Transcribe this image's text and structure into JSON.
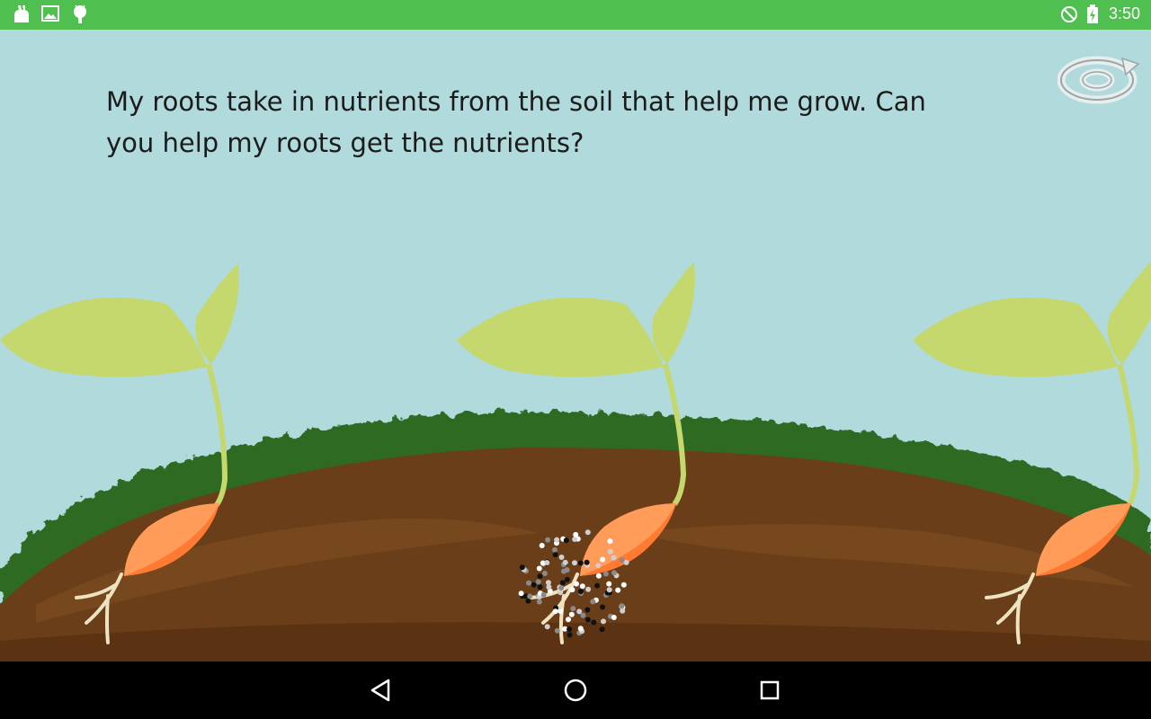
{
  "status_bar": {
    "time": "3:50",
    "left_icons": [
      "bunny-icon",
      "image-icon",
      "android-icon"
    ],
    "right_icons": [
      "no-sim-icon",
      "battery-charging-icon"
    ],
    "color": "#4fbf4f"
  },
  "scene": {
    "narration": "My roots take in nutrients from the soil that help me grow. Can you help my roots get the nutrients?",
    "sky_color": "#b0dadb",
    "soil_color": "#6b3e1a",
    "grass_color": "#2f6b22",
    "leaf_color": "#c5d86d",
    "seed_color": "#ff7a33",
    "plants": [
      "seedling-left",
      "seedling-center",
      "seedling-right"
    ],
    "nutrients": "nutrient-cluster"
  },
  "replay_button": {
    "icon": "replay-icon"
  },
  "nav_bar": {
    "buttons": [
      "back-icon",
      "home-icon",
      "recents-icon"
    ]
  }
}
